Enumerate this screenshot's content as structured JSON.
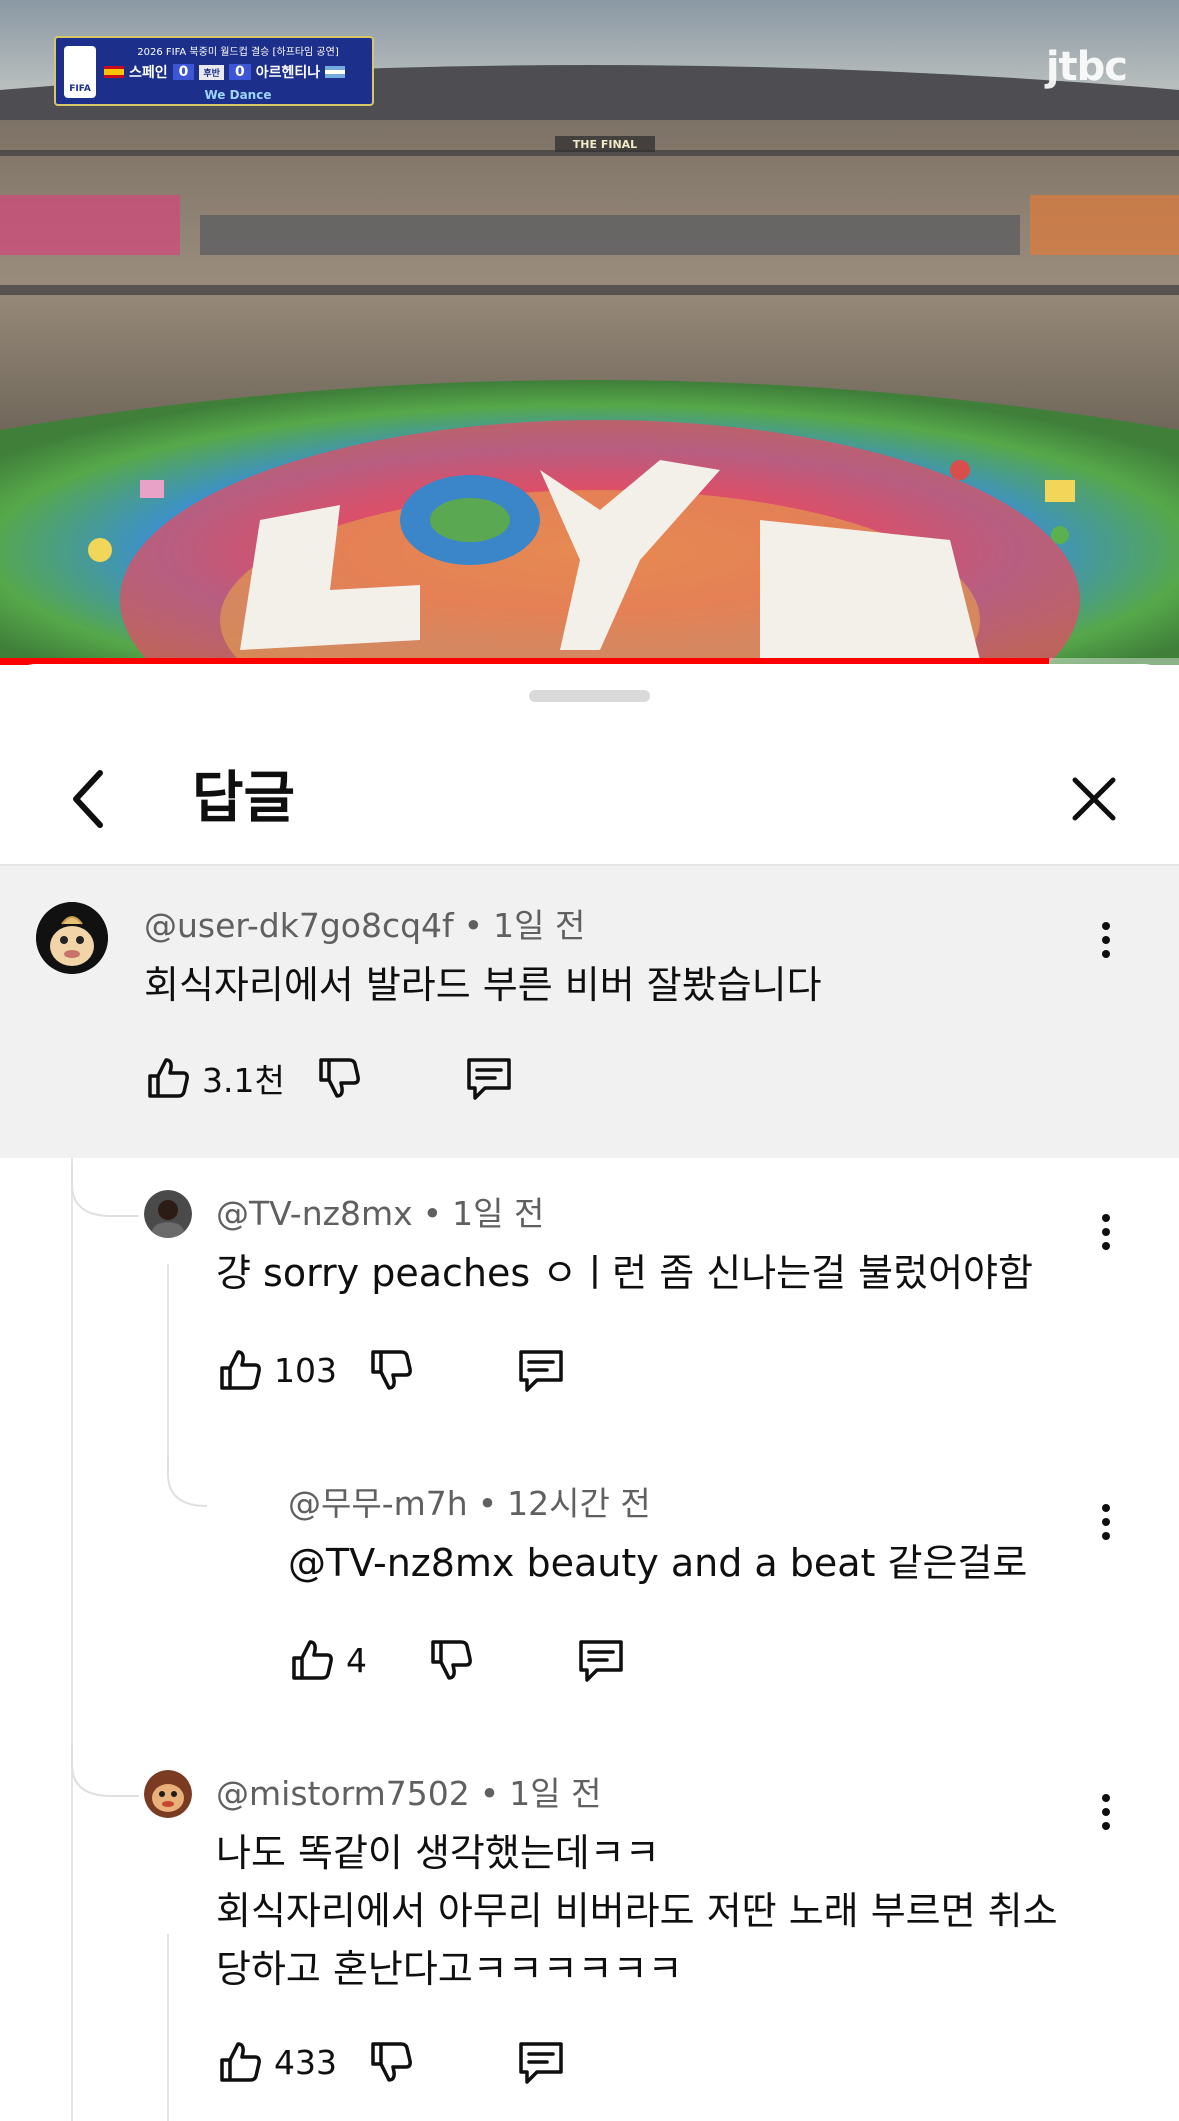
{
  "video": {
    "scorebug": {
      "headline": "2026 FIFA 북중미 월드컵 결승 [하프타임 공연]",
      "team_home": "스페인",
      "score_home": "0",
      "period": "후반",
      "score_away": "0",
      "team_away": "아르헨티나",
      "song": "We Dance",
      "cup_label": "FIFA"
    },
    "banner_text": "THE FINAL",
    "broadcaster": "jtbc",
    "progress": 0.89
  },
  "sheet": {
    "title": "답글"
  },
  "comments": [
    {
      "author": "@user-dk7go8cq4f",
      "time": "1일 전",
      "lines": [
        "회식자리에서 발라드 부른 비버 잘봤습니다"
      ],
      "likes": "3.1천"
    },
    {
      "author": "@TV-nz8mx",
      "time": "1일 전",
      "lines": [
        "걍 sorry peaches ㅇㅣ런 좀 신나는걸 불렀어야함"
      ],
      "likes": "103"
    },
    {
      "author": "@무무-m7h",
      "time": "12시간 전",
      "lines": [
        "@TV-nz8mx beauty and a beat 같은걸로"
      ],
      "likes": "4"
    },
    {
      "author": "@mistorm7502",
      "time": "1일 전",
      "lines": [
        "나도 똑같이 생각했는데ㅋㅋ",
        "회식자리에서 아무리 비버라도 저딴 노래 부르면 취소",
        "당하고 혼난다고ㅋㅋㅋㅋㅋㅋ"
      ],
      "likes": "433"
    }
  ],
  "icons": {
    "back": "chevron-left-icon",
    "close": "close-icon",
    "like": "thumbs-up-icon",
    "dislike": "thumbs-down-icon",
    "reply": "reply-icon",
    "more": "more-vertical-icon"
  },
  "colors": {
    "progress": "#ff0000",
    "meta_text": "#606060",
    "highlight_bg": "#f1f1f1"
  }
}
